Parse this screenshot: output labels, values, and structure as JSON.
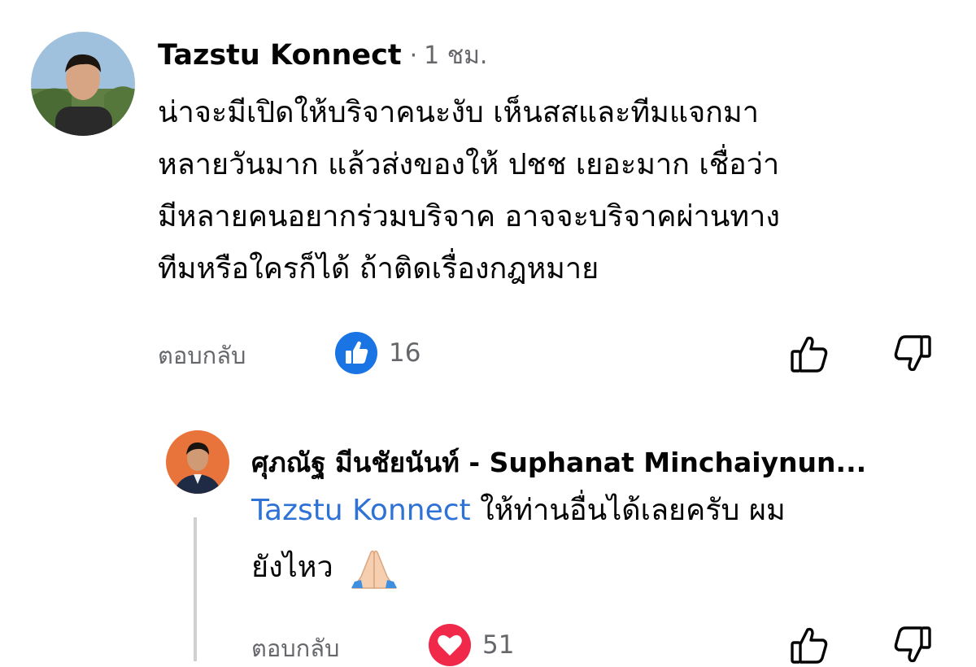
{
  "colors": {
    "like_blue": "#1b74e4",
    "heart_red": "#f02849",
    "mention_blue": "#2f72d6",
    "meta_gray": "#65676b"
  },
  "comment": {
    "author": "Tazstu Konnect",
    "separator": "·",
    "time": "1 ชม.",
    "lines": [
      "น่าจะมีเปิดให้บริจาคนะงับ เห็นสสและทีมแจกมา",
      "หลายวันมาก แล้วส่งของให้ ปชช เยอะมาก เชื่อว่า",
      "มีหลายคนอยากร่วมบริจาค อาจจะบริจาคผ่านทาง",
      "ทีมหรือใครก็ได้ ถ้าติดเรื่องกฎหมาย"
    ],
    "reply_label": "ตอบกลับ",
    "reaction_icon": "like-icon",
    "reaction_count": "16"
  },
  "reply": {
    "author": "ศุภณัฐ มีนชัยนันท์ - Suphanat Minchaiynun...",
    "mention": "Tazstu Konnect",
    "line1_rest": " ให้ท่านอื่นได้เลยครับ ผม",
    "line2": "ยังไหว",
    "emoji": "🙏",
    "emoji_icon": "folded-hands-icon",
    "reply_label": "ตอบกลับ",
    "reaction_icon": "heart-icon",
    "reaction_count": "51"
  }
}
